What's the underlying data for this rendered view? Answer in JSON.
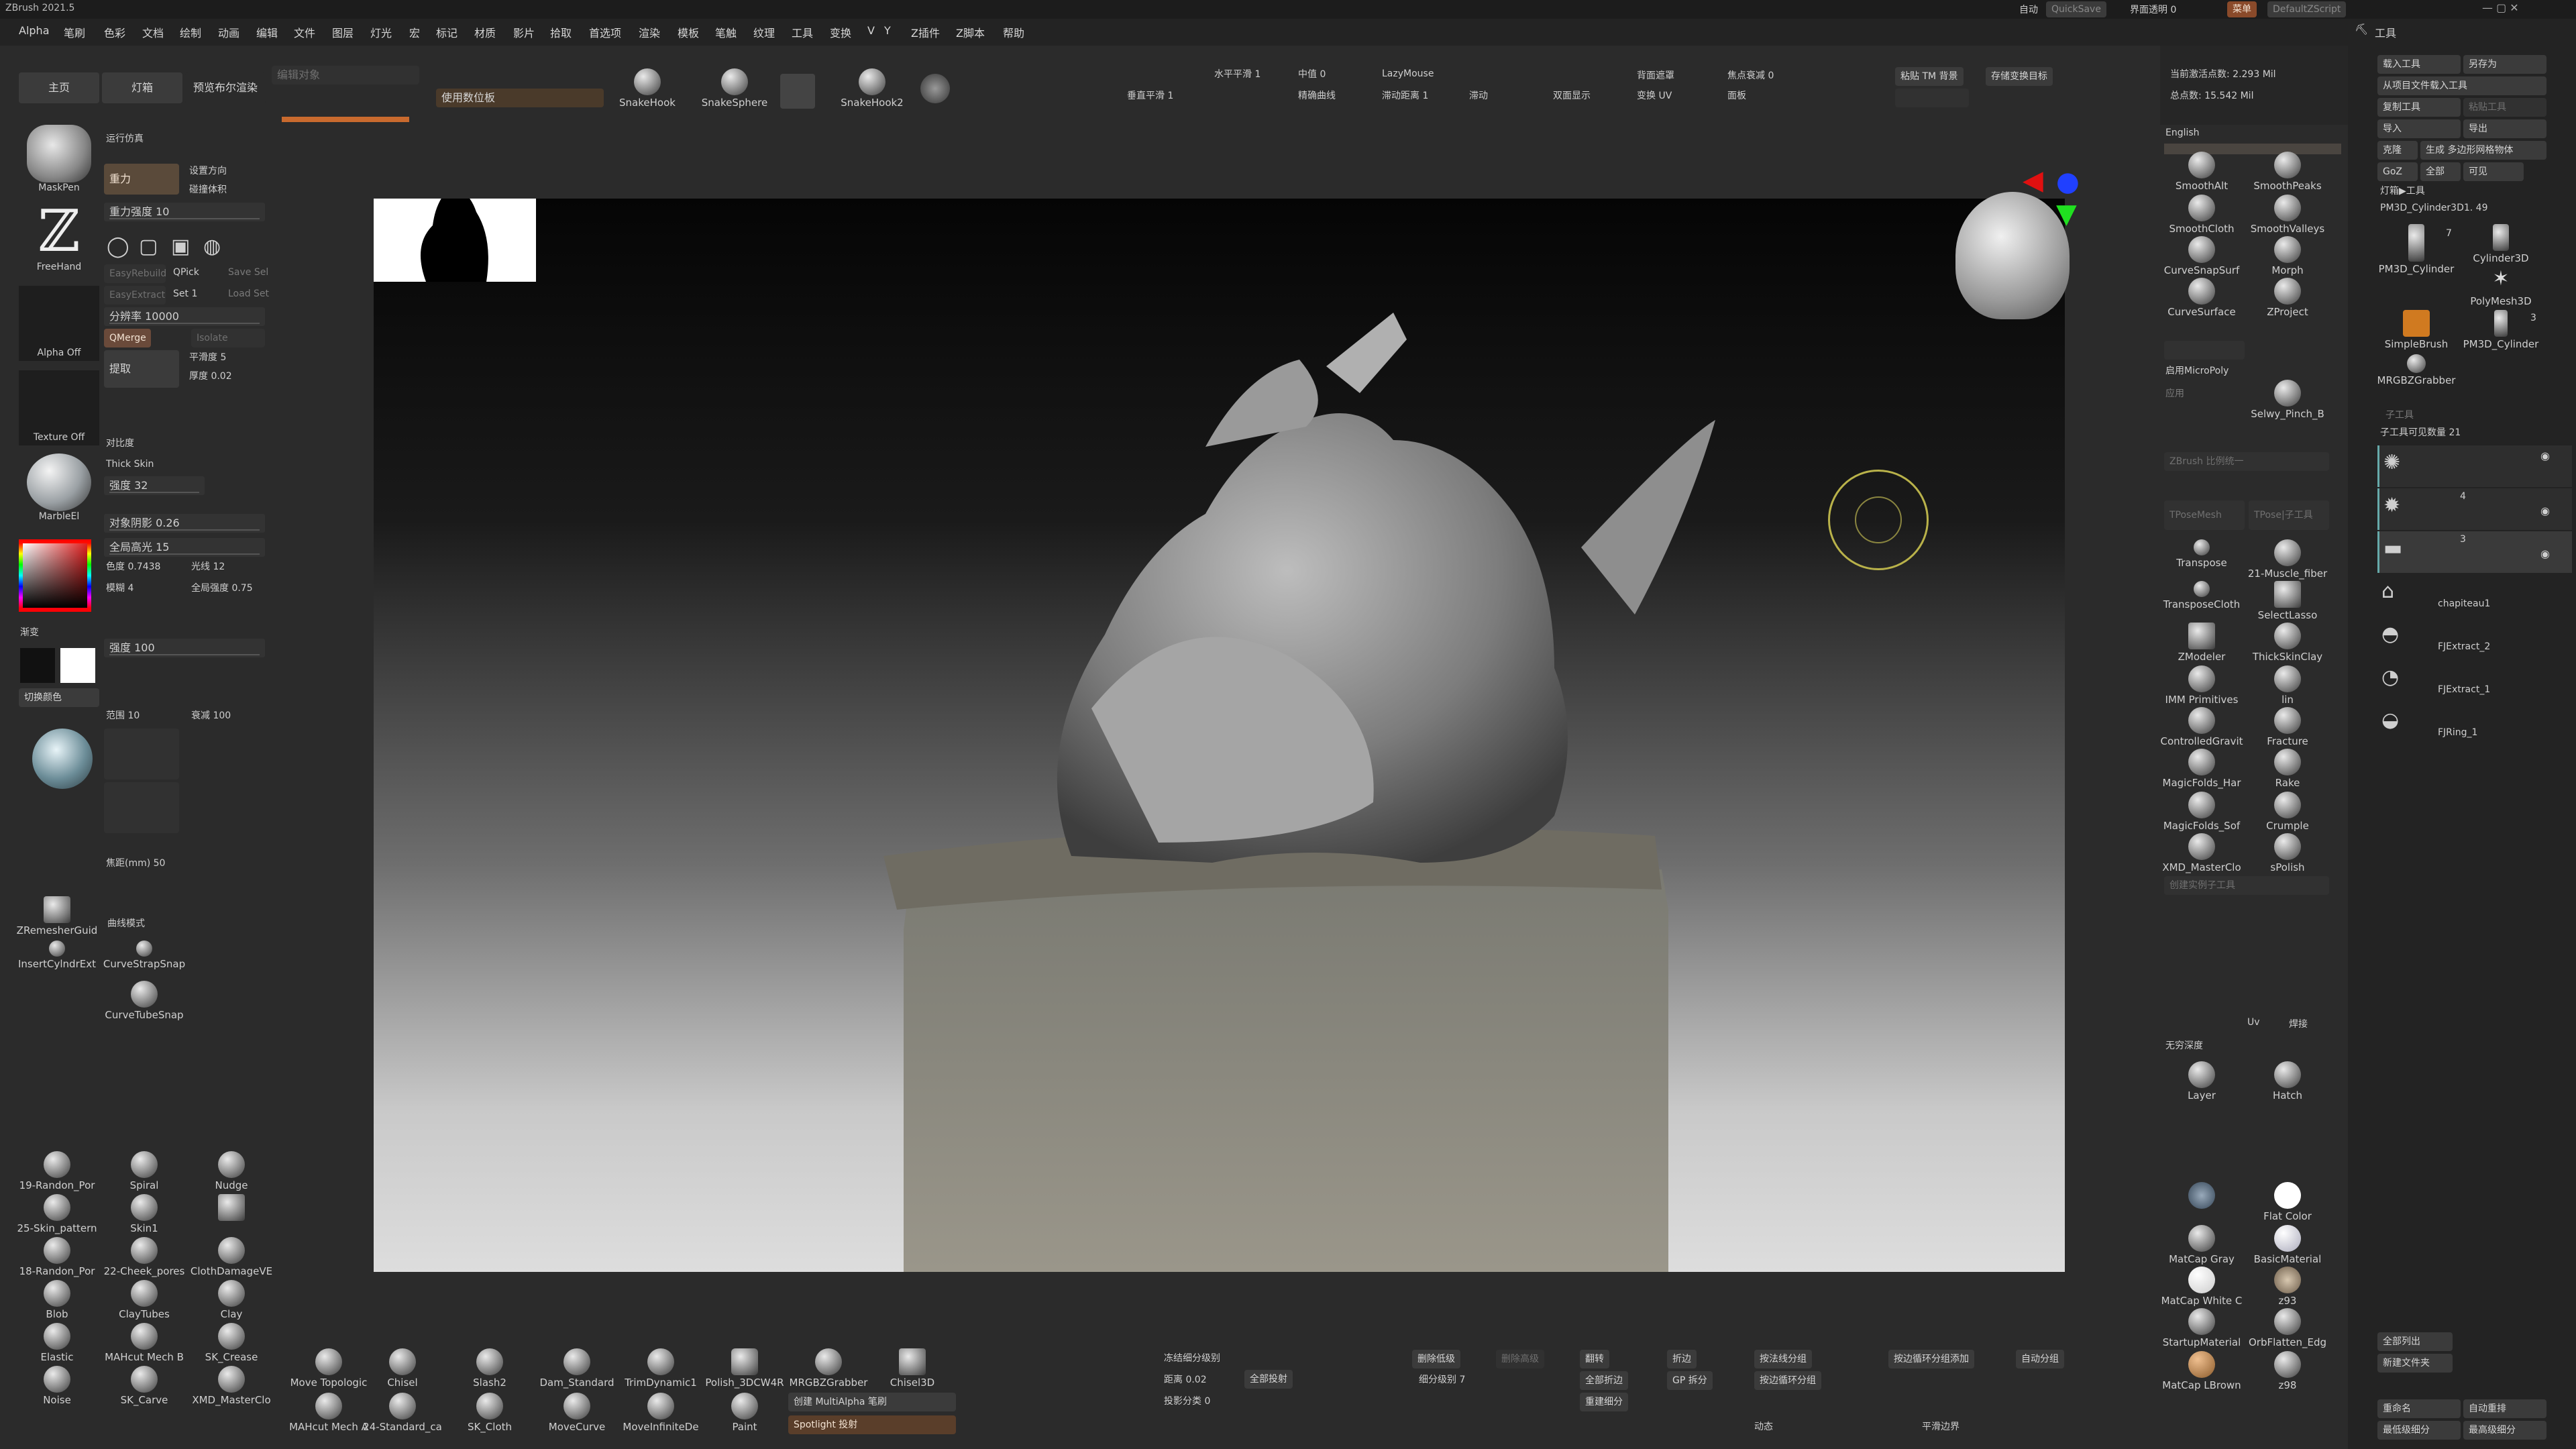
{
  "window": {
    "title": "ZBrush 2021.5",
    "quicksave": "QuickSave",
    "transparency": "界面透明 0",
    "menus_btn": "菜单",
    "script": "DefaultZScript",
    "auto": "自动"
  },
  "menubar": [
    "Alpha",
    "笔刷",
    "色彩",
    "文档",
    "绘制",
    "动画",
    "编辑",
    "文件",
    "图层",
    "灯光",
    "宏",
    "标记",
    "材质",
    "影片",
    "拾取",
    "首选项",
    "渲染",
    "模板",
    "笔触",
    "纹理",
    "工具",
    "变换",
    "V",
    "Y",
    "Z插件",
    "Z脚本",
    "帮助"
  ],
  "tool_palette_title": "工具",
  "top_shelf": {
    "home": "主页",
    "lightbox": "灯箱",
    "bpr": "预览布尔渲染",
    "edit_object": "编辑对象",
    "use_digitizer": "使用数位板",
    "snakehook": "SnakeHook",
    "snakesphere": "SnakeSphere",
    "snakehook2": "SnakeHook2",
    "h_smooth": "水平平滑 1",
    "v_smooth": "垂直平滑 1",
    "mid_value": "中值 0",
    "smooth_curve": "精确曲线",
    "lazymouse": "LazyMouse",
    "lazy_radius": "滞动距离 1",
    "lazy_step": "滞动",
    "double_side": "双面显示",
    "backface": "背面遮罩",
    "transform_uv": "变换 UV",
    "focal_falloff": "焦点衰减 0",
    "backface_label": "面板",
    "paste_tm": "粘贴 TM 背景",
    "save_as_tool": "存储变换目标",
    "active_points": "当前激活点数: 2.293 Mil",
    "total_points": "总点数: 15.542 Mil"
  },
  "left_panel": {
    "run_sim": "运行仿真",
    "gravity": "重力",
    "gravity_dir": "设置方向",
    "collision": "碰撞体积",
    "gravity_strength": "重力强度 10",
    "maskpen": "MaskPen",
    "freehand": "FreeHand",
    "alpha_off": "Alpha Off",
    "texture_off": "Texture Off",
    "material": "MarbleEl",
    "easyrebuild": "EasyRebuild",
    "qpick": "QPick",
    "savesel": "Save Sel",
    "easyextract": "EasyExtract",
    "set1": "Set 1",
    "loadset": "Load Set",
    "resolution": "分辨率 10000",
    "zremesh": "QMerge",
    "isolate": "Isolate",
    "smooth": "平滑度 5",
    "thickness": "厚度 0.02",
    "extract": "提取",
    "thick_skin": "Thick Skin",
    "strength": "强度 32",
    "shadow": "对象阴影 0.26",
    "contrast": "对比度",
    "highlight": "全局高光 15",
    "hue": "色度 0.7438",
    "lightness": "光线 12",
    "blur": "模糊 4",
    "global_strength": "全局强度 0.75",
    "gradient": "渐变",
    "strength100": "强度 100",
    "switch_color": "切换颜色",
    "range": "范围 10",
    "falloff": "衰减 100",
    "focal": "焦距(mm) 50",
    "zremesher": "ZRemesherGuid",
    "curve_mode": "曲线模式",
    "insert_cyl": "InsertCylndrExt",
    "curvestrap": "CurveStrapSnap",
    "curvetube": "CurveTubeSnap"
  },
  "left_brushes": [
    {
      "name": "19-Randon_Por"
    },
    {
      "name": "Spiral"
    },
    {
      "name": "Nudge"
    },
    {
      "name": "25-Skin_pattern"
    },
    {
      "name": "Skin1"
    },
    {
      "name": ""
    },
    {
      "name": "18-Randon_Por"
    },
    {
      "name": "22-Cheek_pores"
    },
    {
      "name": "ClothDamageVE"
    },
    {
      "name": "Blob"
    },
    {
      "name": "ClayTubes"
    },
    {
      "name": "Clay"
    },
    {
      "name": "Elastic"
    },
    {
      "name": "MAHcut Mech B"
    },
    {
      "name": "SK_Crease"
    },
    {
      "name": "Noise"
    },
    {
      "name": "SK_Carve"
    },
    {
      "name": "XMD_MasterClo"
    }
  ],
  "bottom_brushes": [
    {
      "name": "Move Topologic"
    },
    {
      "name": "Chisel"
    },
    {
      "name": "Slash2"
    },
    {
      "name": "Dam_Standard"
    },
    {
      "name": "TrimDynamic1"
    },
    {
      "name": "Polish_3DCW4R"
    },
    {
      "name": "MRGBZGrabber"
    },
    {
      "name": "Chisel3D"
    },
    {
      "name": "MAHcut Mech A"
    },
    {
      "name": "24-Standard_ca"
    },
    {
      "name": "SK_Cloth"
    },
    {
      "name": "MoveCurve"
    },
    {
      "name": "MoveInfiniteDe"
    },
    {
      "name": "Paint"
    }
  ],
  "bottom_bar": {
    "freeze_subdiv": "冻结细分级别",
    "distance": "距离 0.02",
    "projection": "投影分类 0",
    "full_project": "全部投射",
    "subdiv_level": "细分级别 7",
    "delete_lower": "删除低级",
    "delete_higher": "删除高级",
    "reconstruct": "重建细分",
    "flip": "翻转",
    "fold": "折边",
    "dynamic": "动态",
    "smooth_edges": "平滑边界",
    "multialpha": "创建 MultiAlpha 笔刷",
    "spotlight": "Spotlight 投射",
    "group_by_normal": "按法线分组",
    "add_subdiv": "按边循环分组",
    "crease_all": "全部折边",
    "gp_split": "GP 拆分",
    "auto_groups": "自动分组",
    "dynamic_subdiv": "按边循环分组添加"
  },
  "right_brush_panel": {
    "lang": "English",
    "brushes": [
      {
        "name": "SmoothAlt"
      },
      {
        "name": "SmoothPeaks"
      },
      {
        "name": "SmoothCloth"
      },
      {
        "name": "SmoothValleys"
      },
      {
        "name": "CurveSnapSurf"
      },
      {
        "name": "Morph"
      },
      {
        "name": "CurveSurface"
      },
      {
        "name": "ZProject"
      },
      {
        "name": "Selwy_Pinch_B"
      },
      {
        "name": "Transpose"
      },
      {
        "name": "21-Muscle_fiber"
      },
      {
        "name": "TransposeCloth"
      },
      {
        "name": "SelectLasso"
      },
      {
        "name": "ZModeler"
      },
      {
        "name": "ThickSkinClay"
      },
      {
        "name": "IMM Primitives"
      },
      {
        "name": "lin"
      },
      {
        "name": "ControlledGravit"
      },
      {
        "name": "Fracture"
      },
      {
        "name": "MagicFolds_Har"
      },
      {
        "name": "Rake"
      },
      {
        "name": "MagicFolds_Sof"
      },
      {
        "name": "Crumple"
      },
      {
        "name": "XMD_MasterClo"
      },
      {
        "name": "sPolish"
      },
      {
        "name": "Layer"
      },
      {
        "name": "Hatch"
      }
    ],
    "enable_micropoly": "启用MicroPoly",
    "apply": "应用",
    "zbrush_scale": "ZBrush 比例统一",
    "tposemesh": "TPoseMesh",
    "tpose_subtool": "TPose|子工具",
    "create_instance": "创建实例子工具",
    "uv": "Uv",
    "weld": "焊接",
    "infinite_depth": "无穷深度",
    "materials": [
      {
        "name": ""
      },
      {
        "name": "Flat Color"
      },
      {
        "name": "MatCap Gray"
      },
      {
        "name": "BasicMaterial"
      },
      {
        "name": "MatCap White C"
      },
      {
        "name": "z93"
      },
      {
        "name": "StartupMaterial"
      },
      {
        "name": "OrbFlatten_Edg"
      },
      {
        "name": "MatCap LBrown"
      },
      {
        "name": "z98"
      }
    ]
  },
  "tool_panel": {
    "load_tool": "载入工具",
    "save_as": "另存为",
    "load_from_project": "从项目文件载入工具",
    "copy_tool": "复制工具",
    "paste_tool": "粘贴工具",
    "import": "导入",
    "export": "导出",
    "clone": "克隆",
    "make_polymesh": "生成 多边形网格物体",
    "goz": "GoZ",
    "all": "全部",
    "visible": "可见",
    "lightbox_tools": "灯箱▶工具",
    "current_tool": "PM3D_Cylinder3D1. 49",
    "tools": [
      {
        "name": "PM3D_Cylinder",
        "count": "7"
      },
      {
        "name": "Cylinder3D",
        "count": ""
      },
      {
        "name": "SimpleBrush",
        "count": ""
      },
      {
        "name": "PolyMesh3D",
        "count": ""
      },
      {
        "name": "MRGBZGrabber",
        "count": ""
      },
      {
        "name": "PM3D_Cylinder",
        "count": "3"
      }
    ],
    "subtool_header": "子工具",
    "subtool_count": "子工具可见数量 21",
    "subtools": [
      {
        "name": "",
        "count": ""
      },
      {
        "name": "",
        "count": "4"
      },
      {
        "name": "",
        "count": "3"
      },
      {
        "name": "chapiteau1",
        "count": ""
      },
      {
        "name": "FJExtract_2",
        "count": ""
      },
      {
        "name": "FJExtract_1",
        "count": ""
      },
      {
        "name": "FJRing_1",
        "count": ""
      }
    ],
    "rename": "重命名",
    "auto_reorder": "自动重排",
    "all_low": "最低级细分",
    "all_high": "最高级细分",
    "list_all": "全部列出",
    "new_folder": "新建文件夹"
  },
  "colors": {
    "accent": "#c96a2e",
    "canvas_top": "#050505",
    "canvas_bottom": "#d8d8d8",
    "model": "#8a8a86"
  }
}
